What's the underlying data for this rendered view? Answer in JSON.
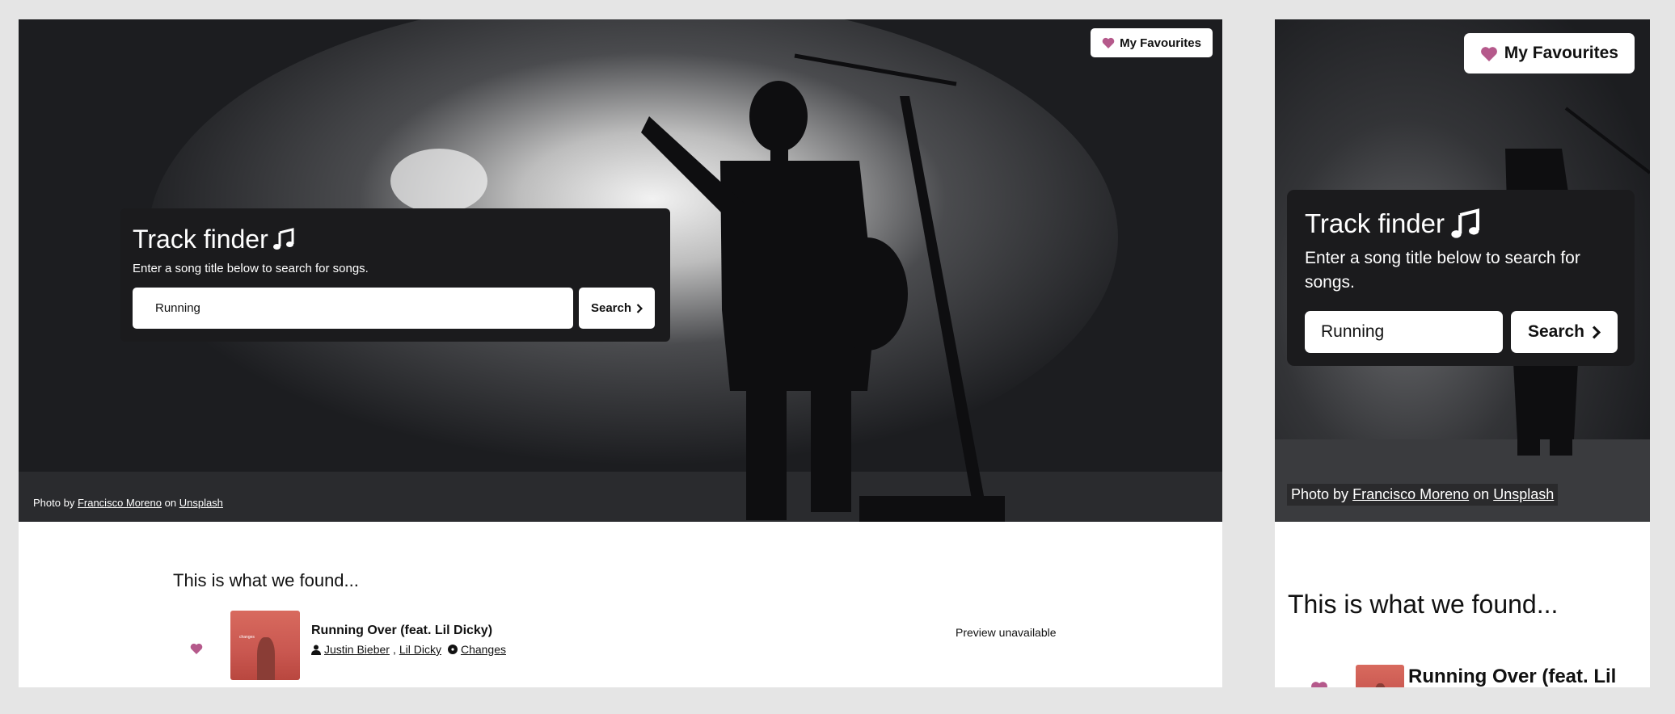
{
  "favourites_label": "My Favourites",
  "hero": {
    "title": "Track finder",
    "subtitle": "Enter a song title below to search for songs.",
    "search_value": "Running",
    "search_button": "Search",
    "credit": {
      "prefix": "Photo by",
      "author": "Francisco Moreno",
      "middle": "on",
      "site": "Unsplash"
    }
  },
  "results": {
    "heading": "This is what we found...",
    "tracks": [
      {
        "title": "Running Over (feat. Lil Dicky)",
        "artists": [
          "Justin Bieber",
          "Lil Dicky"
        ],
        "album": "Changes",
        "preview": "Preview unavailable",
        "cover_text": "changes"
      }
    ]
  },
  "colors": {
    "accent_heart": "#b5598b",
    "panel": "#1b1b1d",
    "page_bg": "#e5e5e5"
  }
}
